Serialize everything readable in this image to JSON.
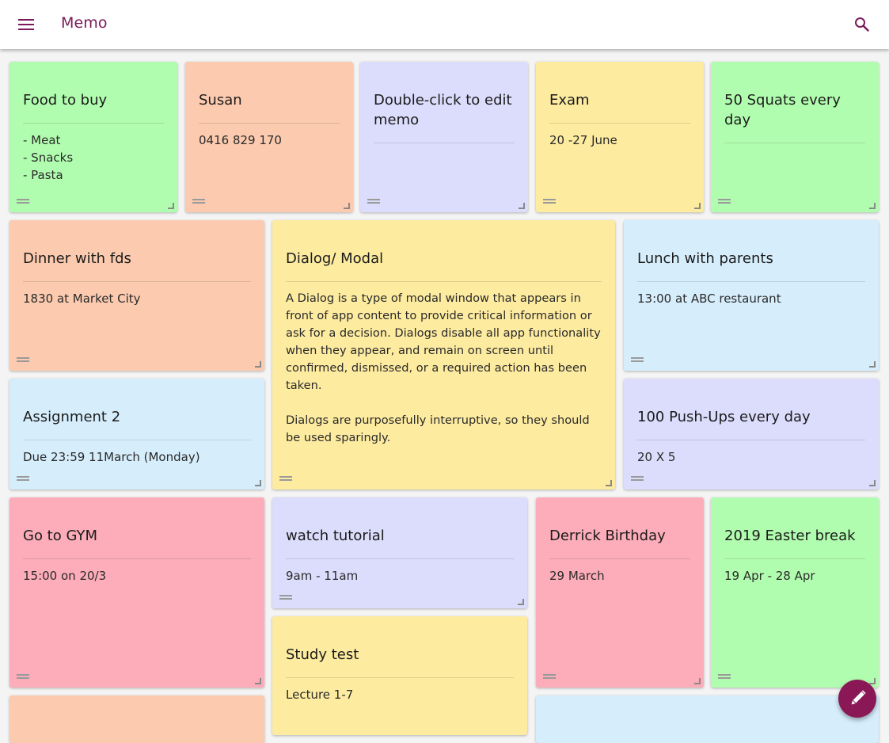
{
  "app": {
    "title": "Memo"
  },
  "icons": {
    "menu": "menu-icon",
    "search": "search-icon",
    "fab": "pencil-icon"
  },
  "colors": {
    "accent": "#7b1a5a",
    "green": "#b1fdaf",
    "peach": "#fccbaf",
    "lavender": "#dcdcfc",
    "yellow": "#fdeba0",
    "blue": "#d6eefc",
    "pink": "#fcadb9"
  },
  "notes": [
    {
      "title": "Food to buy",
      "body": "- Meat\n- Snacks\n- Pasta"
    },
    {
      "title": "Susan",
      "body": "0416 829 170"
    },
    {
      "title": "Double-click to edit memo",
      "body": ""
    },
    {
      "title": "Exam",
      "body": "20 -27 June"
    },
    {
      "title": "50 Squats every day",
      "body": ""
    },
    {
      "title": "Dinner with fds",
      "body": "1830 at Market City"
    },
    {
      "title": "Dialog/ Modal",
      "body": "A Dialog is a type of modal window that appears in front of app content to provide critical information or ask for a decision. Dialogs disable all app functionality when they appear, and remain on screen until confirmed, dismissed, or a required action has been taken.\n\nDialogs are purposefully interruptive, so they should be used sparingly."
    },
    {
      "title": "Lunch with parents",
      "body": "13:00 at ABC restaurant"
    },
    {
      "title": "Assignment 2",
      "body": "Due 23:59 11March (Monday)"
    },
    {
      "title": "100 Push-Ups every day",
      "body": "20 X 5"
    },
    {
      "title": "Go to GYM",
      "body": "15:00 on 20/3"
    },
    {
      "title": "watch tutorial",
      "body": "9am - 11am"
    },
    {
      "title": "Derrick Birthday",
      "body": "29 March"
    },
    {
      "title": "2019 Easter break",
      "body": "19 Apr - 28 Apr"
    },
    {
      "title": "Study test",
      "body": "Lecture 1-7"
    },
    {
      "title": "",
      "body": ""
    },
    {
      "title": "",
      "body": ""
    }
  ]
}
